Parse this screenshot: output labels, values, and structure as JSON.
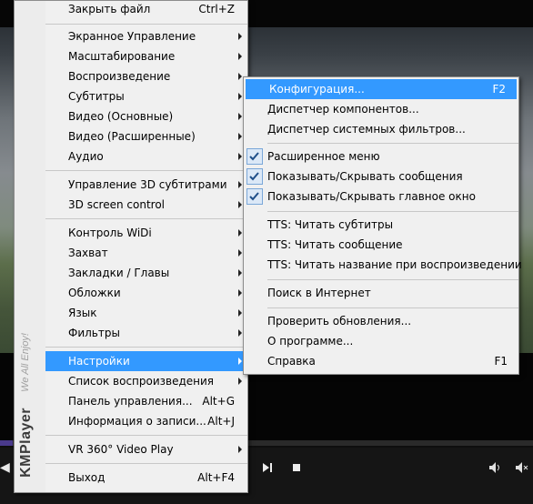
{
  "main_menu": {
    "brand": {
      "logo": "KMPlayer",
      "tagline": "We All Enjoy!"
    },
    "items": [
      {
        "label": "Закрыть файл",
        "shortcut": "Ctrl+Z"
      },
      {
        "label": "Экранное Управление"
      },
      {
        "label": "Масштабирование"
      },
      {
        "label": "Воспроизведение"
      },
      {
        "label": "Субтитры"
      },
      {
        "label": "Видео (Основные)"
      },
      {
        "label": "Видео (Расширенные)"
      },
      {
        "label": "Аудио"
      },
      {
        "label": "Управление 3D субтитрами"
      },
      {
        "label": "3D screen control"
      },
      {
        "label": "Контроль WiDi"
      },
      {
        "label": "Захват"
      },
      {
        "label": "Закладки / Главы"
      },
      {
        "label": "Обложки"
      },
      {
        "label": "Язык"
      },
      {
        "label": "Фильтры"
      },
      {
        "label": "Настройки"
      },
      {
        "label": "Список воспроизведения"
      },
      {
        "label": "Панель управления...",
        "shortcut": "Alt+G"
      },
      {
        "label": "Информация о записи...",
        "shortcut": "Alt+J"
      },
      {
        "label": "VR 360° Video Play"
      },
      {
        "label": "Выход",
        "shortcut": "Alt+F4"
      }
    ],
    "highlighted": "Настройки"
  },
  "settings_submenu": {
    "items": [
      {
        "label": "Конфигурация...",
        "shortcut": "F2"
      },
      {
        "label": "Диспетчер компонентов..."
      },
      {
        "label": "Диспетчер системных фильтров..."
      },
      {
        "label": "Расширенное меню",
        "checked": true
      },
      {
        "label": "Показывать/Скрывать сообщения",
        "checked": true
      },
      {
        "label": "Показывать/Скрывать главное окно",
        "checked": true
      },
      {
        "label": "TTS: Читать субтитры"
      },
      {
        "label": "TTS: Читать сообщение"
      },
      {
        "label": "TTS: Читать название при воспроизведении"
      },
      {
        "label": "Поиск в Интернет"
      },
      {
        "label": "Проверить обновления..."
      },
      {
        "label": "О программе..."
      },
      {
        "label": "Справка",
        "shortcut": "F1"
      }
    ],
    "highlighted": "Конфигурация..."
  },
  "player": {
    "controls": [
      "play-icon",
      "stop-icon",
      "volume-icon",
      "mute-icon"
    ],
    "accent": "#4a3a8c"
  },
  "colors": {
    "highlight": "#3399ff",
    "menu_bg": "#f0f0f0",
    "check": "#1f4f8a"
  }
}
